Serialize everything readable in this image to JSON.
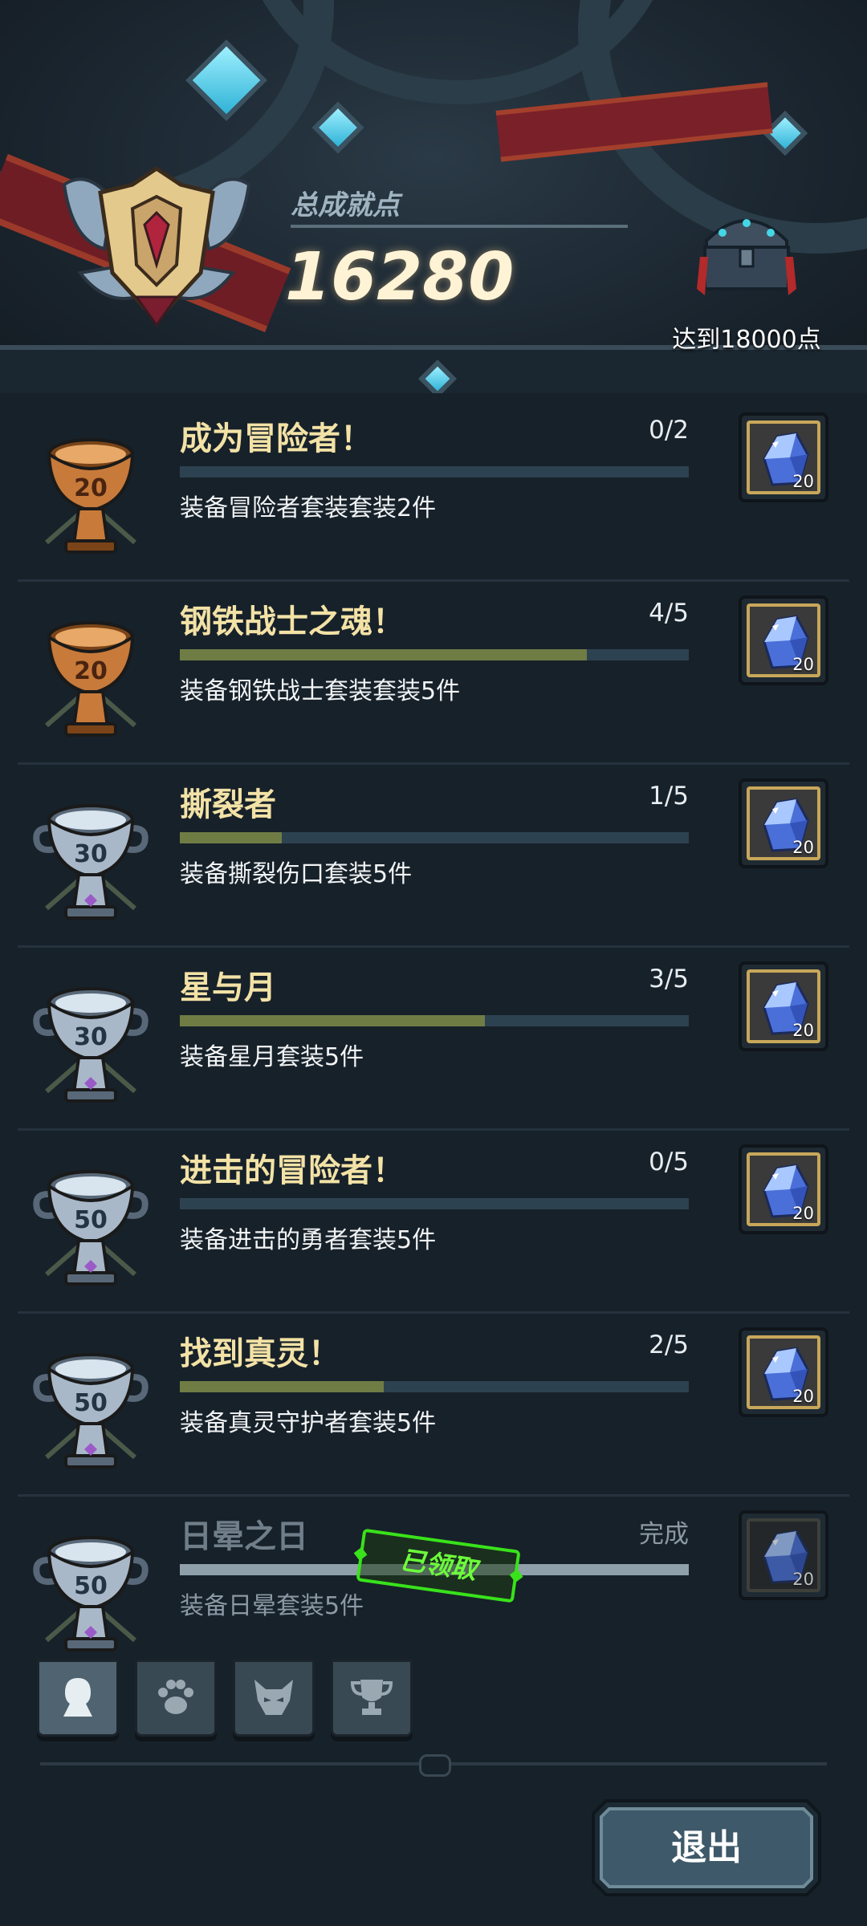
{
  "header": {
    "score_label": "总成就点",
    "score_value": "16280",
    "chest_reward_text": "达到18000点"
  },
  "achievements": [
    {
      "trophy": "bronze",
      "trophy_points": "20",
      "title": "成为冒险者！",
      "count": "0/2",
      "progress": 0.0,
      "description": "装备冒险者套装套装2件",
      "reward_amount": "20",
      "status": "in-progress"
    },
    {
      "trophy": "bronze",
      "trophy_points": "20",
      "title": "钢铁战士之魂！",
      "count": "4/5",
      "progress": 0.8,
      "description": "装备钢铁战士套装套装5件",
      "reward_amount": "20",
      "status": "in-progress"
    },
    {
      "trophy": "silver",
      "trophy_points": "30",
      "title": "撕裂者",
      "count": "1/5",
      "progress": 0.2,
      "description": "装备撕裂伤口套装5件",
      "reward_amount": "20",
      "status": "in-progress"
    },
    {
      "trophy": "silver",
      "trophy_points": "30",
      "title": "星与月",
      "count": "3/5",
      "progress": 0.6,
      "description": "装备星月套装5件",
      "reward_amount": "20",
      "status": "in-progress"
    },
    {
      "trophy": "silver",
      "trophy_points": "50",
      "title": "进击的冒险者！",
      "count": "0/5",
      "progress": 0.0,
      "description": "装备进击的勇者套装5件",
      "reward_amount": "20",
      "status": "in-progress"
    },
    {
      "trophy": "silver",
      "trophy_points": "50",
      "title": "找到真灵！",
      "count": "2/5",
      "progress": 0.4,
      "description": "装备真灵守护者套装5件",
      "reward_amount": "20",
      "status": "in-progress"
    },
    {
      "trophy": "silver",
      "trophy_points": "50",
      "title": "日晕之日",
      "count": "完成",
      "progress": 1.0,
      "description": "装备日晕套装5件",
      "reward_amount": "20",
      "status": "claimed",
      "claimed_label": "已领取"
    }
  ],
  "tabs": [
    {
      "icon": "character-silhouette-icon",
      "active": true
    },
    {
      "icon": "paw-icon",
      "active": false
    },
    {
      "icon": "demon-mask-icon",
      "active": false
    },
    {
      "icon": "trophy-icon",
      "active": false
    }
  ],
  "footer": {
    "exit_label": "退出"
  },
  "colors": {
    "background": "#17212a",
    "title_gold": "#f3e2a6",
    "progress_fill": "#6f7d45",
    "progress_track": "#2d4250",
    "claimed_green": "#39e21b",
    "reward_frame_gold": "#c8a75a"
  }
}
